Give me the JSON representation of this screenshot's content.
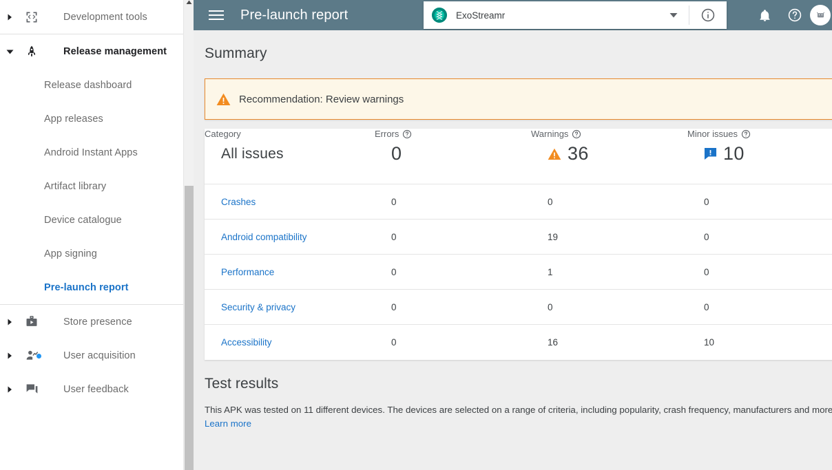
{
  "colors": {
    "header_bg": "#5c7a88",
    "accent_link": "#1a73c8",
    "warning_orange": "#e8892b",
    "minor_blue": "#1a73c8",
    "banner_bg": "#fdf7e8"
  },
  "sidebar": {
    "groups": [
      {
        "label": "Development tools",
        "icon": "code-brackets-icon",
        "expanded": false,
        "children": []
      },
      {
        "label": "Release management",
        "icon": "rocket-icon",
        "expanded": true,
        "children": [
          {
            "label": "Release dashboard",
            "active": false
          },
          {
            "label": "App releases",
            "active": false
          },
          {
            "label": "Android Instant Apps",
            "active": false
          },
          {
            "label": "Artifact library",
            "active": false
          },
          {
            "label": "Device catalogue",
            "active": false
          },
          {
            "label": "App signing",
            "active": false
          },
          {
            "label": "Pre-launch report",
            "active": true
          }
        ]
      },
      {
        "label": "Store presence",
        "icon": "store-briefcase-icon",
        "expanded": false,
        "children": []
      },
      {
        "label": "User acquisition",
        "icon": "user-chart-icon",
        "expanded": false,
        "has_dot": true,
        "children": []
      },
      {
        "label": "User feedback",
        "icon": "chat-bubbles-icon",
        "expanded": false,
        "children": []
      }
    ]
  },
  "header": {
    "menu_icon": "hamburger-icon",
    "title": "Pre-launch report",
    "app_name": "ExoStreamr",
    "app_icon": "exostreamr-app-icon",
    "caret_icon": "chevron-down-icon",
    "info_icon": "info-circle-icon",
    "notifications_icon": "bell-icon",
    "help_icon": "help-circle-icon",
    "avatar_icon": "android-avatar-icon"
  },
  "summary": {
    "title": "Summary",
    "banner": {
      "icon": "warning-triangle-icon",
      "text": "Recommendation: Review warnings"
    }
  },
  "table": {
    "columns": [
      {
        "label": "Category",
        "help": false
      },
      {
        "label": "Errors",
        "help": true
      },
      {
        "label": "Warnings",
        "help": true
      },
      {
        "label": "Minor issues",
        "help": true
      }
    ],
    "summary_row": {
      "category": "All issues",
      "errors": "0",
      "errors_icon": "",
      "warnings": "36",
      "warnings_icon": "warning-triangle-icon",
      "minor": "10",
      "minor_icon": "minor-issue-bubble-icon"
    },
    "rows": [
      {
        "category": "Crashes",
        "errors": "0",
        "warnings": "0",
        "minor": "0"
      },
      {
        "category": "Android compatibility",
        "errors": "0",
        "warnings": "19",
        "minor": "0"
      },
      {
        "category": "Performance",
        "errors": "0",
        "warnings": "1",
        "minor": "0"
      },
      {
        "category": "Security & privacy",
        "errors": "0",
        "warnings": "0",
        "minor": "0"
      },
      {
        "category": "Accessibility",
        "errors": "0",
        "warnings": "16",
        "minor": "10"
      }
    ]
  },
  "test_results": {
    "title": "Test results",
    "description": "This APK was tested on 11 different devices. The devices are selected on a range of criteria, including popularity, crash frequency, manufacturers and more.",
    "link": "Learn more"
  }
}
